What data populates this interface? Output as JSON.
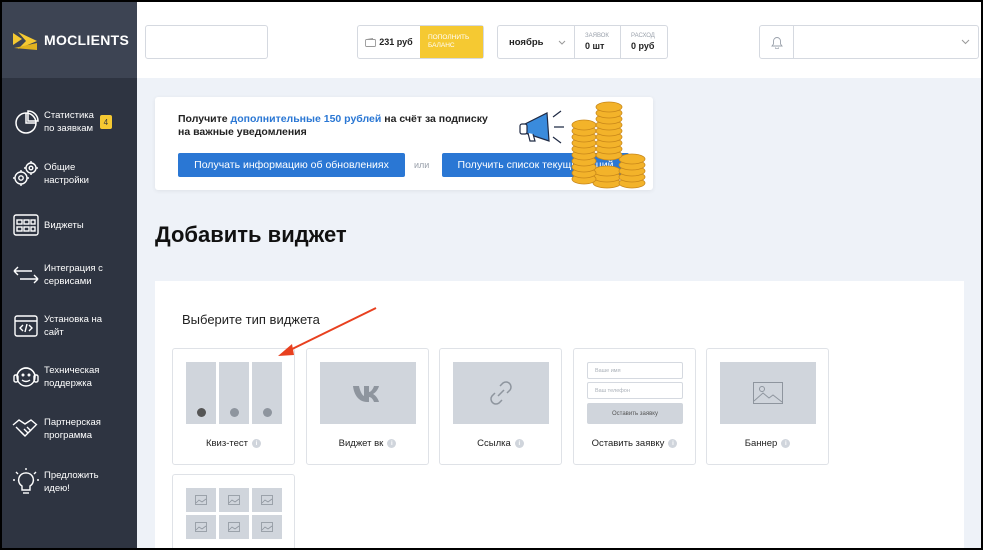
{
  "brand": {
    "name": "MOCLIENTS",
    "color": "#f5c932"
  },
  "sidebar": {
    "items": [
      {
        "label": "Статистика\nпо заявкам",
        "icon": "pie-chart-icon",
        "badge": "4"
      },
      {
        "label": "Общие\nнастройки",
        "icon": "gears-icon"
      },
      {
        "label": "Виджеты",
        "icon": "widgets-icon"
      },
      {
        "label": "Интеграция с\nсервисами",
        "icon": "arrows-exchange-icon"
      },
      {
        "label": "Установка на\nсайт",
        "icon": "code-window-icon"
      },
      {
        "label": "Техническая\nподдержка",
        "icon": "support-face-icon"
      },
      {
        "label": "Партнерская\nпрограмма",
        "icon": "handshake-icon"
      },
      {
        "label": "Предложить\nидею!",
        "icon": "lightbulb-icon"
      }
    ]
  },
  "topbar": {
    "balance": "231 руб",
    "topup_label": "ПОПОЛНИТЬ\nБАЛАНС",
    "month": "ноябрь",
    "requests_caption": "ЗАЯВОК",
    "requests_value": "0 шт",
    "expense_caption": "РАСХОД",
    "expense_value": "0 руб"
  },
  "promo": {
    "text_before": "Получите ",
    "text_highlight": "дополнительные 150 рублей",
    "text_after": " на счёт за подписку\nна важные уведомления",
    "button_updates": "Получать информацию об обновлениях",
    "or": "или",
    "button_promos": "Получить список текущих акций"
  },
  "page_title": "Добавить виджет",
  "panel": {
    "title": "Выберите тип виджета",
    "cards": [
      {
        "label": "Квиз-тест"
      },
      {
        "label": "Виджет вк"
      },
      {
        "label": "Ссылка"
      },
      {
        "label": "Оставить заявку"
      },
      {
        "label": "Баннер"
      }
    ],
    "form_preview": {
      "name_placeholder": "Ваше имя",
      "phone_placeholder": "Ваш телефон",
      "submit": "Оставить заявку"
    },
    "info_symbol": "i"
  },
  "colors": {
    "sidebar": "#2e3441",
    "accent_blue": "#2a77d4",
    "arrow_red": "#e8401f"
  }
}
